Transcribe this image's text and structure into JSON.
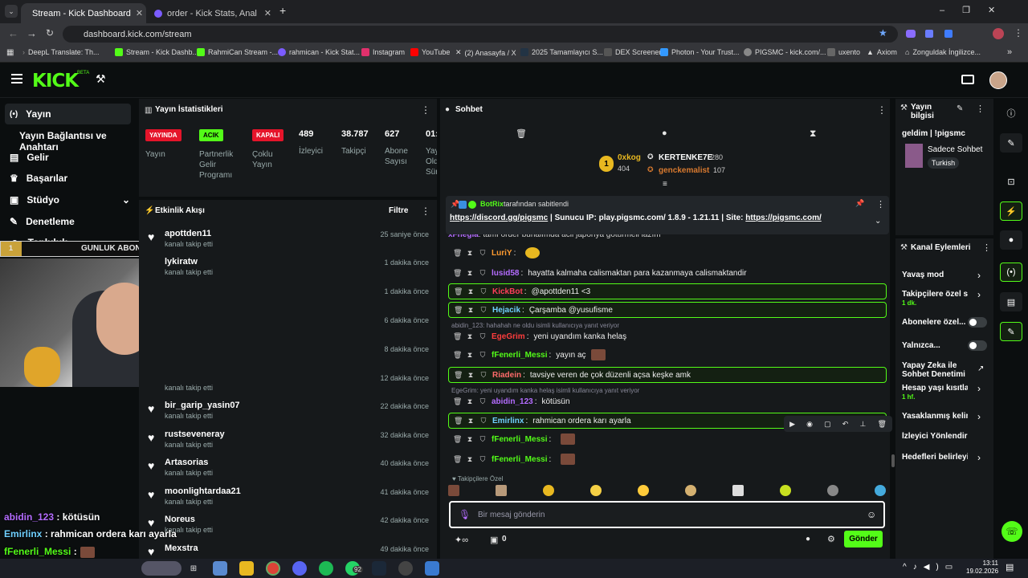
{
  "browser": {
    "tabs": [
      {
        "title": "Stream - Kick Dashboard",
        "active": true
      },
      {
        "title": "order - Kick Stats, Analytics and",
        "active": false
      }
    ],
    "url": "dashboard.kick.com/stream",
    "bookmarks": [
      "DeepL Translate: Th...",
      "Stream - Kick Dashb...",
      "RahmiCan Stream -...",
      "rahmican - Kick Stat...",
      "Instagram",
      "YouTube",
      "(2) Anasayfa / X",
      "2025 Tamamlayıcı S...",
      "DEX Screener",
      "Photon - Your Trust...",
      "PIGSMC - kick.com/...",
      "uxento",
      "Axiom",
      "Zonguldak İngilizce..."
    ]
  },
  "header": {
    "logo": "KICK",
    "beta": "BETA"
  },
  "nav": {
    "items": [
      "Yayın",
      "Yayın Bağlantısı ve Anahtarı",
      "Gelir",
      "Başarılar",
      "Stüdyo",
      "Denetleme",
      "Topluluk"
    ]
  },
  "overlay": {
    "goal_label": "GUNLUK ABONE",
    "goal_start": "1",
    "goal_target": "10",
    "chat": [
      {
        "user": "abidin_123",
        "text": " : kötüsün"
      },
      {
        "user": "Emirlinx",
        "text": " : rahmican ordera karı ayarla"
      },
      {
        "user": "fFenerli_Messi",
        "text": " :"
      }
    ]
  },
  "stats": {
    "title": "Yayın İstatistikleri",
    "items": [
      {
        "badge": "YAYINDA",
        "label": "Yayın"
      },
      {
        "badge": "ACIK",
        "label": "Partnerlik Gelir Programı"
      },
      {
        "badge": "KAPALI",
        "label": "Çoklu Yayın"
      }
    ],
    "numbers": [
      {
        "value": "489",
        "label": "İzleyici"
      },
      {
        "value": "38.787",
        "label": "Takipçi"
      },
      {
        "value": "627",
        "label": "Abone Sayısı"
      },
      {
        "value": "01:",
        "label": "Yay Old Sür"
      }
    ]
  },
  "activity": {
    "title": "Etkinlik Akışı",
    "filter": "Filtre",
    "rows": [
      {
        "name": "apottden11",
        "sub": "kanalı takip etti",
        "time": "25 saniye önce"
      },
      {
        "name": "lykiratw",
        "sub": "kanalı takip etti",
        "time": "1 dakika önce"
      },
      {
        "name": "",
        "sub": "",
        "time": "1 dakika önce"
      },
      {
        "name": "",
        "sub": "",
        "time": "6 dakika önce"
      },
      {
        "name": "",
        "sub": "",
        "time": "8 dakika önce"
      },
      {
        "name": "",
        "sub": "kanalı takip etti",
        "time": "12 dakika önce"
      },
      {
        "name": "bir_garip_yasin07",
        "sub": "kanalı takip etti",
        "time": "22 dakika önce"
      },
      {
        "name": "rustsevenerау",
        "sub": "kanalı takip etti",
        "time": "32 dakika önce"
      },
      {
        "name": "Artasorias",
        "sub": "kanalı takip etti",
        "time": "40 dakika önce"
      },
      {
        "name": "moonlightardaa21",
        "sub": "kanalı takip etti",
        "time": "41 dakika önce"
      },
      {
        "name": "Noreus",
        "sub": "kanalı takip etti",
        "time": "42 dakika önce"
      },
      {
        "name": "Mexstra",
        "sub": "",
        "time": "49 dakika önce"
      }
    ]
  },
  "chat": {
    "title": "Sohbet",
    "leaders": {
      "first_name": "0xkog",
      "first_value": "404",
      "second_name": "KERTENKE7E",
      "second_value": "280",
      "third_name": "genckemalist",
      "third_value": "107"
    },
    "pinned": {
      "by": "BotRix",
      "by_suffix": "tarafından sabitlendi",
      "link1": "https://discord.gg/pigsmc",
      "mid": " | Sunucu IP: play.pigsmc.com/ 1.8.9 - 1.21.11 | Site: ",
      "link2": "https://pigsmc.com/"
    },
    "partial_top": "tamı order bunalımda acil japonya götürmeli lazım",
    "partial_user": "xFnegla",
    "messages": [
      {
        "user": "LuriY",
        "text": "",
        "color": "#ff9b2f",
        "hl": false
      },
      {
        "user": "lusid58",
        "text": "hayatta kalmaha calismaktan para kazanmaya calismaktandir",
        "color": "#b46cff",
        "hl": false
      },
      {
        "user": "KickBot",
        "text": "@apottden11 <3",
        "color": "#ff3d5a",
        "hl": true
      },
      {
        "user": "Hejacik",
        "text": "Çarşamba @yusufisme",
        "color": "#6fd0ff",
        "hl": true
      },
      {
        "user": "EgeGrim",
        "text": "yeni uyandım kanka helaş",
        "color": "#ff3d3d",
        "hl": false
      },
      {
        "user": "fFenerli_Messi",
        "text": "yayın aç",
        "color": "#53fc18",
        "hl": false
      },
      {
        "user": "Riadein",
        "text": "tavsiye veren de çok düzenli açsa keşke amk",
        "color": "#ff6b6b",
        "hl": true
      },
      {
        "user": "abidin_123",
        "text": "kötüsün",
        "color": "#b46cff",
        "hl": false
      },
      {
        "user": "Emirlinx",
        "text": "rahmican ordera karı ayarla",
        "color": "#6fd0ff",
        "hl": true
      },
      {
        "user": "fFenerli_Messi",
        "text": "",
        "color": "#53fc18",
        "hl": false
      },
      {
        "user": "fFenerli_Messi",
        "text": "",
        "color": "#53fc18",
        "hl": false
      }
    ],
    "replies": [
      "abidin_123: hahahah ne oldu isimli kullanıcıya yanıt veriyor",
      "EgeGrim: yeni uyandım kanka helaş isimli kullanıcıya yanıt veriyor"
    ],
    "followers_only": "Takipçilere Özel",
    "input_placeholder": "Bir mesaj gönderin",
    "points": "0",
    "send": "Gönder"
  },
  "info": {
    "title": "Yayın bilgisi",
    "stream_title": "geldim | !pigsmc",
    "category": "Sadece Sohbet",
    "language": "Turkish"
  },
  "channel_actions": {
    "title": "Kanal Eylemleri",
    "items": [
      {
        "label": "Yavaş mod",
        "sub": "",
        "type": "chevron"
      },
      {
        "label": "Takipçilere özel soh",
        "sub": "1 dk.",
        "type": "chevron"
      },
      {
        "label": "Abonelere özel...",
        "sub": "",
        "type": "toggle"
      },
      {
        "label": "Yalnızca...",
        "sub": "",
        "type": "toggle"
      },
      {
        "label": "Yapay Zeka ile Sohbet Denetimi",
        "sub": "",
        "type": "link"
      },
      {
        "label": "Hesap yaşı kısıtlama",
        "sub": "1 hf.",
        "type": "chevron"
      },
      {
        "label": "Yasaklanmış kelime",
        "sub": "",
        "type": "chevron"
      },
      {
        "label": "İzleyici Yönlendir",
        "sub": "",
        "type": "none"
      },
      {
        "label": "Hedefleri belirleyin",
        "sub": "",
        "type": "chevron"
      }
    ]
  },
  "taskbar": {
    "time": "13:11",
    "date": "19.02.2026",
    "badge": "92"
  },
  "colors": {
    "accent": "#53fc18",
    "live": "#e5142a",
    "panel": "#16191b"
  }
}
